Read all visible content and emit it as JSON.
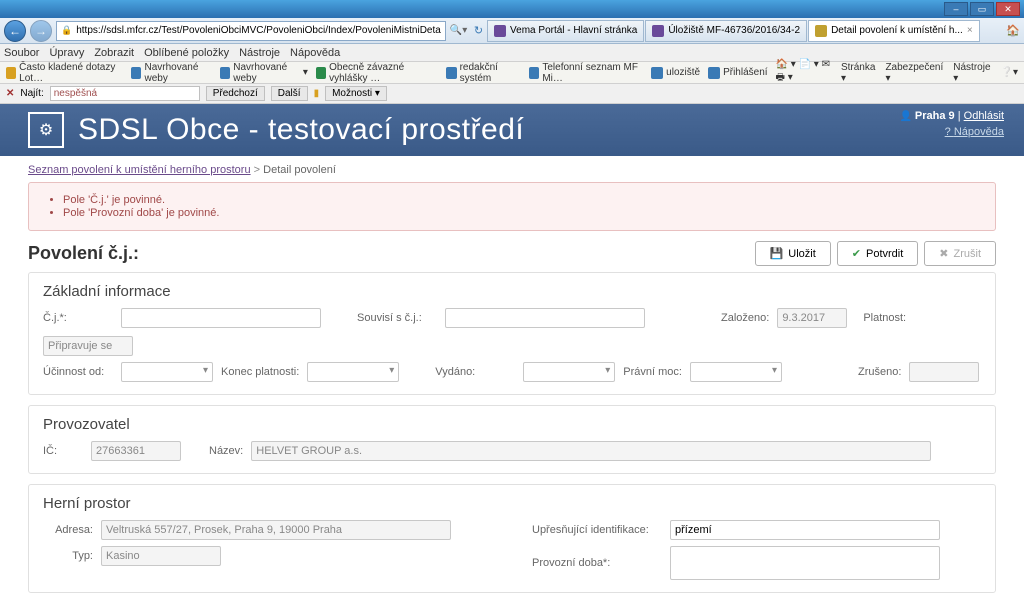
{
  "browser": {
    "url": "https://sdsl.mfcr.cz/Test/PovoleniObciMVC/PovoleniObci/Index/PovoleniMistniDeta",
    "search_hint": "🔍",
    "tabs": [
      {
        "label": "Vema Portál - Hlavní stránka"
      },
      {
        "label": "Úložiště MF-46736/2016/34-2"
      },
      {
        "label": "Detail povolení k umístění h..."
      }
    ],
    "menus": [
      "Soubor",
      "Úpravy",
      "Zobrazit",
      "Oblíbené položky",
      "Nástroje",
      "Nápověda"
    ],
    "bookmarks": [
      "Často kladené dotazy  Lot…",
      "Navrhované weby",
      "Navrhované weby",
      "Obecně závazné vyhlášky …",
      "redakční systém",
      "Telefonní seznam MF  Mi…",
      "uloziště",
      "Přihlášení"
    ],
    "bm_right": [
      "Stránka",
      "Zabezpečení",
      "Nástroje"
    ],
    "find_label": "Najít:",
    "find_value": "nespěšná",
    "find_prev": "Předchozí",
    "find_next": "Další",
    "find_opts": "Možnosti"
  },
  "header": {
    "title": "SDSL Obce - testovací prostředí",
    "user": "Praha 9",
    "logout": "Odhlásit",
    "help": "Nápověda"
  },
  "breadcrumb": {
    "link": "Seznam povolení k umístění herního prostoru",
    "sep": ">",
    "current": "Detail povolení"
  },
  "alert": {
    "items": [
      "Pole 'Č.j.' je povinné.",
      "Pole 'Provozní doba' je povinné."
    ]
  },
  "title_row": {
    "title": "Povolení č.j.:",
    "save": "Uložit",
    "confirm": "Potvrdit",
    "cancel": "Zrušit"
  },
  "basic": {
    "heading": "Základní informace",
    "cj": "Č.j.*:",
    "ucinnost_od": "Účinnost od:",
    "konec_platnosti": "Konec platnosti:",
    "souvisi": "Souvisí s č.j.:",
    "vydano": "Vydáno:",
    "pravni_moc": "Právní moc:",
    "zalozeno": "Založeno:",
    "zalozeno_val": "9.3.2017",
    "platnost": "Platnost:",
    "platnost_val": "Připravuje se",
    "zruseno": "Zrušeno:"
  },
  "provozovatel": {
    "heading": "Provozovatel",
    "ic": "IČ:",
    "ic_val": "27663361",
    "nazev": "Název:",
    "nazev_val": "HELVET GROUP a.s."
  },
  "herni": {
    "heading": "Herní prostor",
    "adresa": "Adresa:",
    "adresa_val": "Veltruská 557/27, Prosek, Praha 9, 19000 Praha",
    "typ": "Typ:",
    "typ_val": "Kasino",
    "upres": "Upřesňující identifikace:",
    "upres_val": "přízemí",
    "provozni": "Provozní doba*:"
  }
}
